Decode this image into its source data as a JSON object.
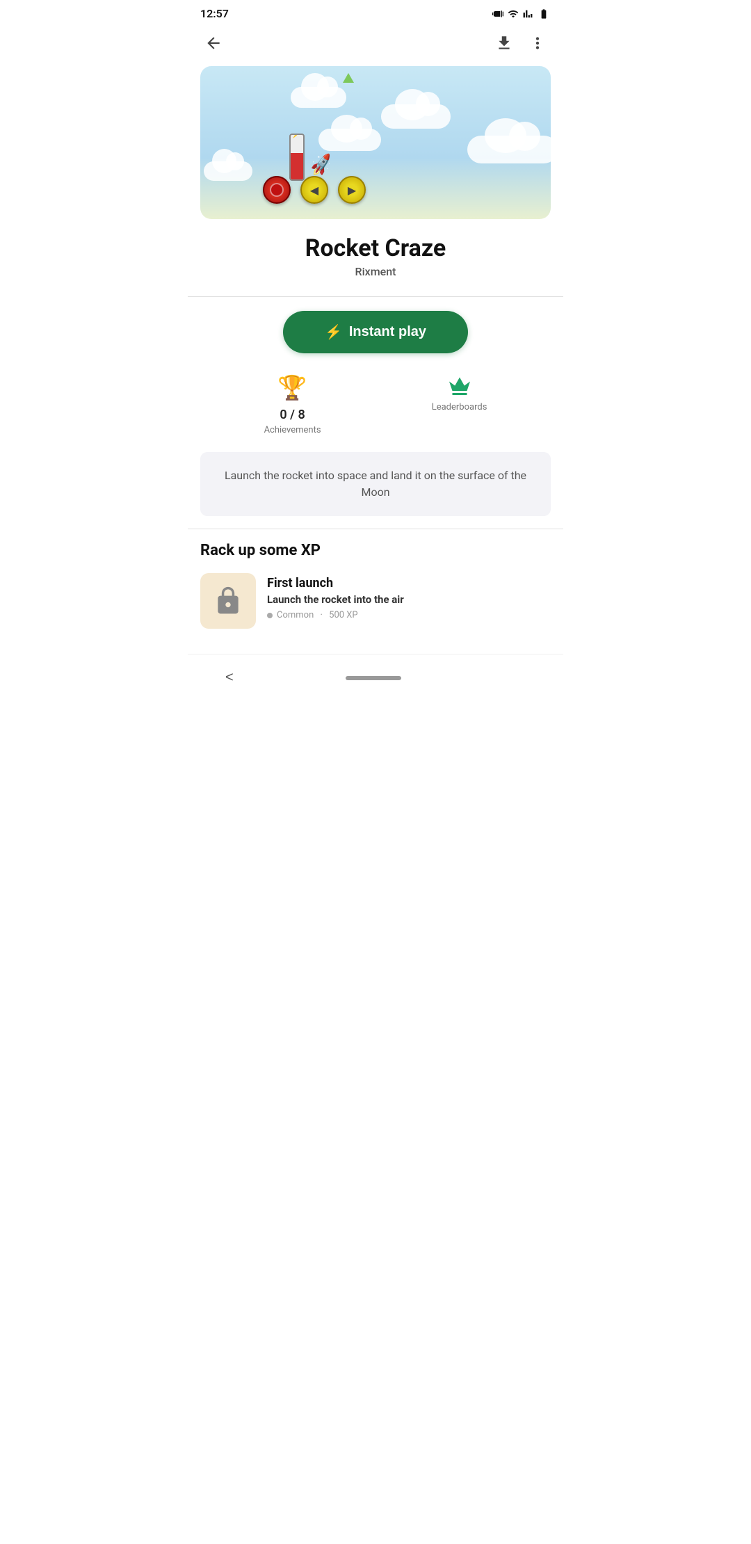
{
  "statusBar": {
    "time": "12:57",
    "icons": [
      "vibrate",
      "wifi",
      "signal",
      "battery"
    ]
  },
  "nav": {
    "back_label": "←",
    "download_label": "⬇",
    "more_label": "⋮"
  },
  "app": {
    "name": "Rocket Craze",
    "developer": "Rixment",
    "instant_play_label": "Instant play",
    "lightning_icon": "⚡"
  },
  "stats": {
    "achievements": {
      "value": "0 / 8",
      "label": "Achievements",
      "icon": "🏆"
    },
    "leaderboards": {
      "label": "Leaderboards",
      "icon": "👑"
    }
  },
  "description": {
    "text": "Launch the rocket into space and land it on the surface of the Moon"
  },
  "xpSection": {
    "title": "Rack up some XP",
    "achievements": [
      {
        "name": "First launch",
        "desc": "Launch the rocket into the air",
        "rarity": "Common",
        "xp": "500 XP"
      }
    ]
  },
  "bottomNav": {
    "back_label": "<"
  }
}
